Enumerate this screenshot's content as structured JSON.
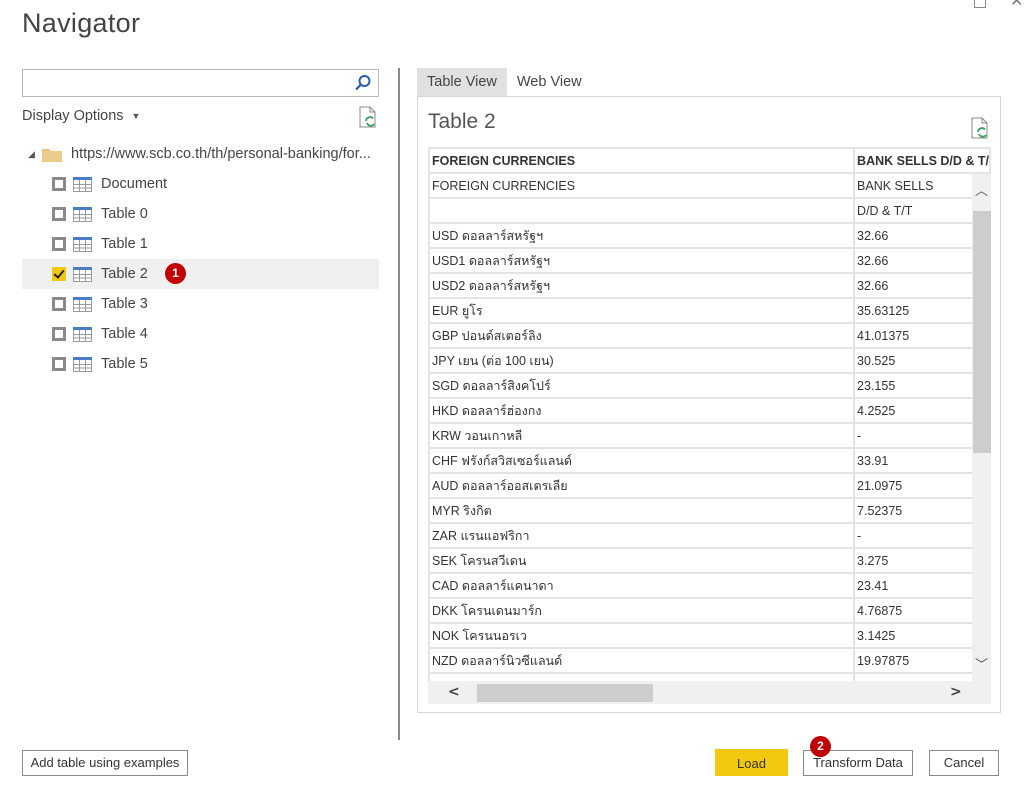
{
  "window": {
    "title": "Navigator"
  },
  "left_panel": {
    "search": {
      "value": "",
      "placeholder": ""
    },
    "display_options_label": "Display Options",
    "tree": {
      "root_label": "https://www.scb.co.th/th/personal-banking/for...",
      "items": [
        {
          "label": "Document",
          "checked": false,
          "selected": false
        },
        {
          "label": "Table 0",
          "checked": false,
          "selected": false
        },
        {
          "label": "Table 1",
          "checked": false,
          "selected": false
        },
        {
          "label": "Table 2",
          "checked": true,
          "selected": true,
          "badge": "1"
        },
        {
          "label": "Table 3",
          "checked": false,
          "selected": false
        },
        {
          "label": "Table 4",
          "checked": false,
          "selected": false
        },
        {
          "label": "Table 5",
          "checked": false,
          "selected": false
        }
      ]
    }
  },
  "right_panel": {
    "tabs": [
      {
        "label": "Table View",
        "active": true
      },
      {
        "label": "Web View",
        "active": false
      }
    ],
    "preview_title": "Table 2",
    "table": {
      "headers": [
        "FOREIGN CURRENCIES",
        "BANK SELLS D/D & T/"
      ],
      "rows": [
        [
          "FOREIGN CURRENCIES",
          "BANK SELLS"
        ],
        [
          "",
          "D/D & T/T"
        ],
        [
          "USD ดอลลาร์สหรัฐฯ",
          "32.66"
        ],
        [
          "USD1 ดอลลาร์สหรัฐฯ",
          "32.66"
        ],
        [
          "USD2 ดอลลาร์สหรัฐฯ",
          "32.66"
        ],
        [
          "EUR ยูโร",
          "35.63125"
        ],
        [
          "GBP ปอนด์สเตอร์ลิง",
          "41.01375"
        ],
        [
          "JPY เยน (ต่อ 100 เยน)",
          "30.525"
        ],
        [
          "SGD ดอลลาร์สิงคโปร์",
          "23.155"
        ],
        [
          "HKD ดอลลาร์ฮ่องกง",
          "4.2525"
        ],
        [
          "KRW วอนเกาหลี",
          "-"
        ],
        [
          "CHF ฟรังก์สวิสเซอร์แลนด์",
          "33.91"
        ],
        [
          "AUD ดอลลาร์ออสเตรเลีย",
          "21.0975"
        ],
        [
          "MYR ริงกิต",
          "7.52375"
        ],
        [
          "ZAR แรนแอฟริกา",
          "-"
        ],
        [
          "SEK โครนสวีเดน",
          "3.275"
        ],
        [
          "CAD ดอลลาร์แคนาดา",
          "23.41"
        ],
        [
          "DKK โครนเดนมาร์ก",
          "4.76875"
        ],
        [
          "NOK โครนนอรเว",
          "3.1425"
        ],
        [
          "NZD ดอลลาร์นิวซีแลนด์",
          "19.97875"
        ],
        [
          "",
          ""
        ]
      ]
    }
  },
  "footer": {
    "add_table_label": "Add table using examples",
    "load_label": "Load",
    "transform_label": "Transform Data",
    "transform_badge": "2",
    "cancel_label": "Cancel"
  },
  "colors": {
    "accent_yellow": "#f2c811",
    "badge_red": "#c00000",
    "selected_row": "#f0f0f0"
  }
}
